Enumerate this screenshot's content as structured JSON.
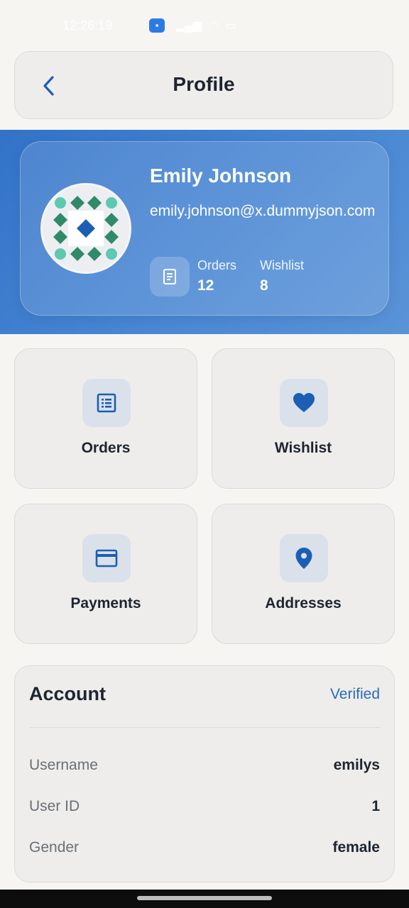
{
  "status_bar": {
    "time": "12:26:19"
  },
  "header": {
    "title": "Profile",
    "back_icon": "chevron-left-icon"
  },
  "profile": {
    "name": "Emily Johnson",
    "email": "emily.johnson@x.dummyjson.com",
    "stats": [
      {
        "label": "Orders",
        "value": "12"
      },
      {
        "label": "Wishlist",
        "value": "8"
      }
    ]
  },
  "tiles": [
    {
      "label": "Orders",
      "icon": "list-document-icon"
    },
    {
      "label": "Wishlist",
      "icon": "heart-icon"
    },
    {
      "label": "Payments",
      "icon": "credit-card-icon"
    },
    {
      "label": "Addresses",
      "icon": "location-pin-icon"
    }
  ],
  "account": {
    "title": "Account",
    "status": "Verified",
    "rows": [
      {
        "label": "Username",
        "value": "emilys"
      },
      {
        "label": "User ID",
        "value": "1"
      },
      {
        "label": "Gender",
        "value": "female"
      }
    ]
  },
  "colors": {
    "accent": "#1a5fb4",
    "hero_gradient_start": "#3272c8",
    "hero_gradient_end": "#5a93d6",
    "verified": "#2a6bb8",
    "background": "#f6f5f2"
  }
}
